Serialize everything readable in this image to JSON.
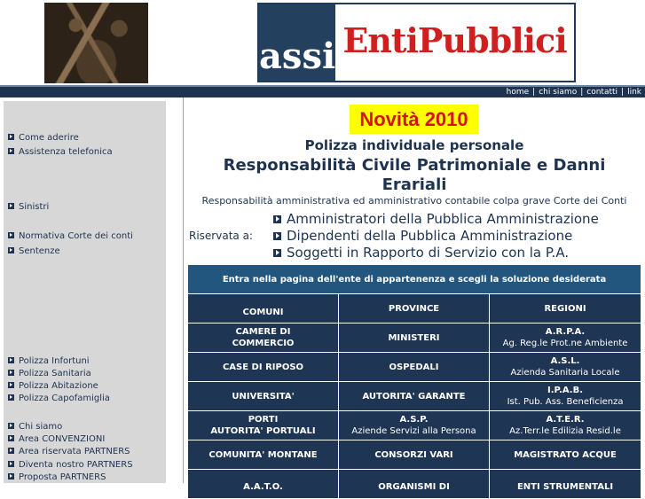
{
  "header": {
    "logo_left": "assi",
    "logo_right": "EntiPubblici"
  },
  "topnav": [
    "home",
    "chi siamo",
    "contatti",
    "link"
  ],
  "sidebar": {
    "items": [
      "Come aderire",
      "Assistenza telefonica",
      "Sinistri",
      "Normativa Corte dei conti",
      "Sentenze",
      "Polizza Infortuni",
      "Polizza Sanitaria",
      "Polizza Abitazione",
      "Polizza Capofamiglia",
      "Chi siamo",
      "Area CONVENZIONI",
      "Area riservata PARTNERS",
      "Diventa nostro PARTNERS",
      "Proposta PARTNERS"
    ]
  },
  "main": {
    "novita": "Novità 2010",
    "polizza_title": "Polizza individuale personale",
    "resp_title": "Responsabilità Civile Patrimoniale e Danni Erariali",
    "resp_sub": "Responsabilità amministrativa ed amministrativo contabile colpa grave Corte dei Conti",
    "riservata_label": "Riservata a:",
    "riservata_items": [
      "Amministratori della Pubblica Amministrazione",
      "Dipendenti della Pubblica Amministrazione",
      "Soggetti in Rapporto di Servizio con la P.A."
    ]
  },
  "grid": {
    "header": "Entra nella pagina dell'ente di appartenenza e scegli la soluzione desiderata",
    "rows": [
      [
        {
          "t": "COMUNI",
          "s": ""
        },
        {
          "t": "PROVINCE",
          "s": ""
        },
        {
          "t": "REGIONI",
          "s": ""
        }
      ],
      [
        {
          "t": "CAMERE DI",
          "s2": "COMMERCIO"
        },
        {
          "t": "MINISTERI",
          "s": ""
        },
        {
          "t": "A.R.P.A.",
          "s": "Ag. Reg.le Prot.ne Ambiente"
        }
      ],
      [
        {
          "t": "CASE DI RIPOSO",
          "s": ""
        },
        {
          "t": "OSPEDALI",
          "s": ""
        },
        {
          "t": "A.S.L.",
          "s": "Azienda Sanitaria Locale"
        }
      ],
      [
        {
          "t": "UNIVERSITA'",
          "s": ""
        },
        {
          "t": "AUTORITA' GARANTE",
          "s": ""
        },
        {
          "t": "I.P.A.B.",
          "s": "Ist. Pub. Ass. Beneficienza"
        }
      ],
      [
        {
          "t": "PORTI",
          "s2": "AUTORITA' PORTUALI"
        },
        {
          "t": "A.S.P.",
          "s": "Aziende Servizi alla Persona"
        },
        {
          "t": "A.T.E.R.",
          "s": "Az.Terr.le Edilizia Resid.le"
        }
      ],
      [
        {
          "t": "COMUNITA' MONTANE",
          "s": ""
        },
        {
          "t": "CONSORZI VARI",
          "s": ""
        },
        {
          "t": "MAGISTRATO ACQUE",
          "s": ""
        }
      ],
      [
        {
          "t": "A.A.T.O.",
          "s": ""
        },
        {
          "t": "ORGANISMI DI",
          "s": ""
        },
        {
          "t": "ENTI STRUMENTALI",
          "s": ""
        }
      ]
    ]
  }
}
